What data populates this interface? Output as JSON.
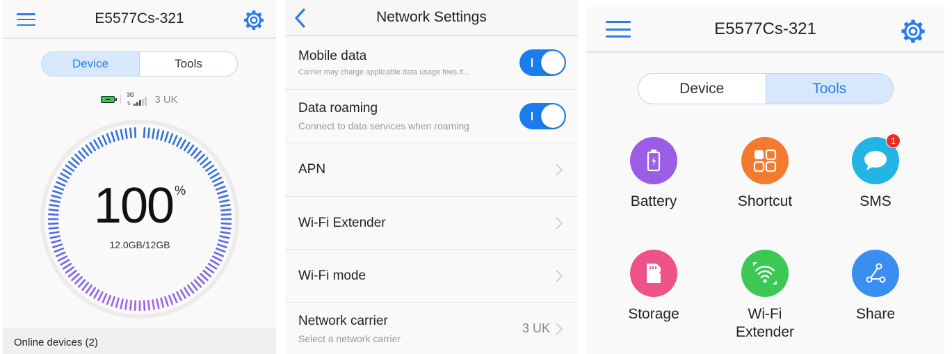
{
  "panels": {
    "home_device": {
      "header": {
        "title": "E5577Cs-321",
        "menu_icon": "hamburger-menu-icon",
        "settings_icon": "gear-icon"
      },
      "segmented": {
        "items": [
          "Device",
          "Tools"
        ],
        "active": "Device"
      },
      "status": {
        "battery_icon": "battery-charging-icon",
        "network_type": "3G",
        "signal_icon": "signal-bars-icon",
        "signal_bars": 3,
        "signal_max": 5,
        "carrier": "3 UK"
      },
      "usage_gauge": {
        "percent": "100",
        "percent_sign": "%",
        "used_total": "12.0GB/12GB",
        "remaining_fraction": 1.0,
        "colors": {
          "start": "#2f6fe0",
          "end": "#a35ff0",
          "track": "#ececec"
        }
      },
      "online_devices": "Online devices (2)"
    },
    "network_settings": {
      "header": {
        "title": "Network Settings",
        "back_icon": "chevron-left-icon"
      },
      "rows": [
        {
          "title": "Mobile data",
          "subtitle": "Carrier may charge applicable data usage fees if...",
          "control": "toggle",
          "on": true
        },
        {
          "title": "Data roaming",
          "subtitle": "Connect to data services when roaming",
          "control": "toggle",
          "on": true
        },
        {
          "title": "APN",
          "control": "chevron"
        },
        {
          "title": "Wi-Fi Extender",
          "control": "chevron"
        },
        {
          "title": "Wi-Fi mode",
          "control": "chevron"
        },
        {
          "title": "Network carrier",
          "subtitle": "Select a network carrier",
          "value": "3 UK",
          "control": "chevron"
        }
      ]
    },
    "home_tools": {
      "header": {
        "title": "E5577Cs-321",
        "menu_icon": "hamburger-menu-icon",
        "settings_icon": "gear-icon"
      },
      "segmented": {
        "items": [
          "Device",
          "Tools"
        ],
        "active": "Tools"
      },
      "tools": [
        {
          "label": "Battery",
          "icon": "battery-icon",
          "color": "#9b5de5"
        },
        {
          "label": "Shortcut",
          "icon": "shortcut-grid-icon",
          "color": "#f47a2f"
        },
        {
          "label": "SMS",
          "icon": "message-bubble-icon",
          "color": "#22b5e3",
          "badge": "1"
        },
        {
          "label": "Storage",
          "icon": "sd-card-icon",
          "color": "#ef5289"
        },
        {
          "label": "Wi-Fi\nExtender",
          "label_lines": [
            "Wi-Fi",
            "Extender"
          ],
          "icon": "wifi-extender-icon",
          "color": "#3dc855"
        },
        {
          "label": "Share",
          "icon": "share-icon",
          "color": "#3a8ef0"
        }
      ]
    }
  },
  "accent": "#2b7de9"
}
